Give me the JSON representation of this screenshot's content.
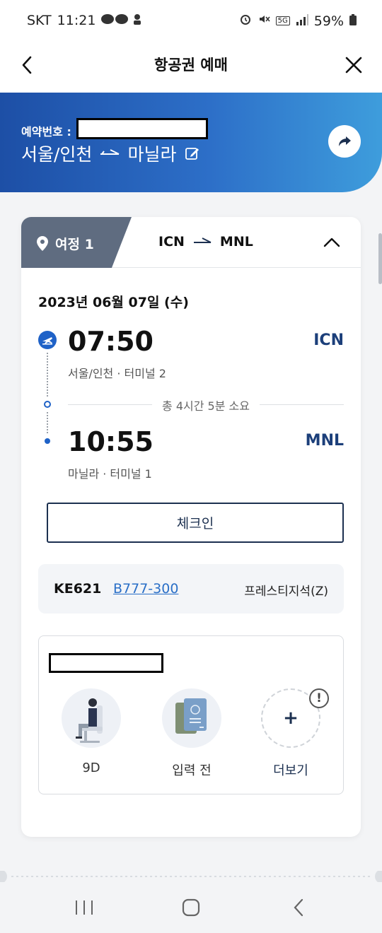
{
  "status_bar": {
    "carrier": "SKT",
    "time": "11:21",
    "network": "5G",
    "battery": "59%"
  },
  "header": {
    "title": "항공권 예매"
  },
  "banner": {
    "reservation_label": "예약번호 :",
    "origin": "서울/인천",
    "destination": "마닐라"
  },
  "leg": {
    "tab_label": "여정 1",
    "from_code": "ICN",
    "to_code": "MNL",
    "date": "2023년 06월 07일 (수)",
    "departure": {
      "time": "07:50",
      "code": "ICN",
      "place": "서울/인천 · 터미널 2"
    },
    "duration": "총 4시간 5분 소요",
    "arrival": {
      "time": "10:55",
      "code": "MNL",
      "place": "마닐라 · 터미널 1"
    },
    "checkin_label": "체크인",
    "flight_number": "KE621",
    "aircraft": "B777-300",
    "cabin": "프레스티지석(Z)"
  },
  "passenger": {
    "services": [
      {
        "label": "9D",
        "icon": "seat-icon"
      },
      {
        "label": "입력 전",
        "icon": "passport-icon"
      },
      {
        "label": "더보기",
        "icon": "plus-icon"
      }
    ]
  },
  "colors": {
    "brand_blue": "#1f62c7",
    "navy": "#1c3050",
    "tab_gray": "#5f6c80",
    "link_blue": "#2a6fc7"
  }
}
